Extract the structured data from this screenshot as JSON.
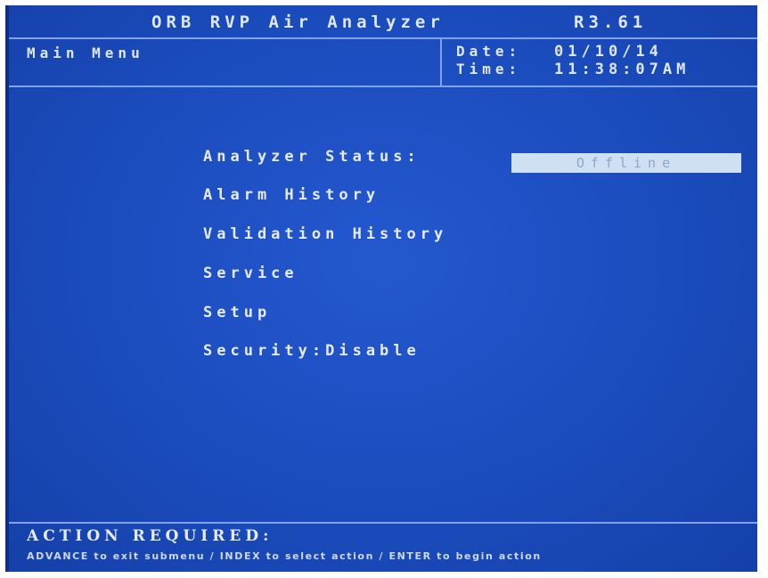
{
  "header": {
    "app_title": "ORB RVP Air Analyzer",
    "version": "R3.61",
    "menu_title": "Main Menu",
    "date_label": "Date:",
    "date_value": "01/10/14",
    "time_label": "Time:",
    "time_value": "11:38:07AM"
  },
  "menu": {
    "analyzer_status_label": "Analyzer Status:",
    "analyzer_status_value": "Offline",
    "items": [
      "Alarm History",
      "Validation History",
      "Service",
      "Setup",
      "Security:Disable"
    ]
  },
  "footer": {
    "action_title": "ACTION REQUIRED:",
    "action_hint": "ADVANCE to exit submenu / INDEX to select action / ENTER to begin action"
  },
  "colors": {
    "screen_background": "#1b4cbd",
    "text": "#e6ebf7",
    "status_box": "#cfe0f2",
    "divider": "#7fa2e8"
  }
}
